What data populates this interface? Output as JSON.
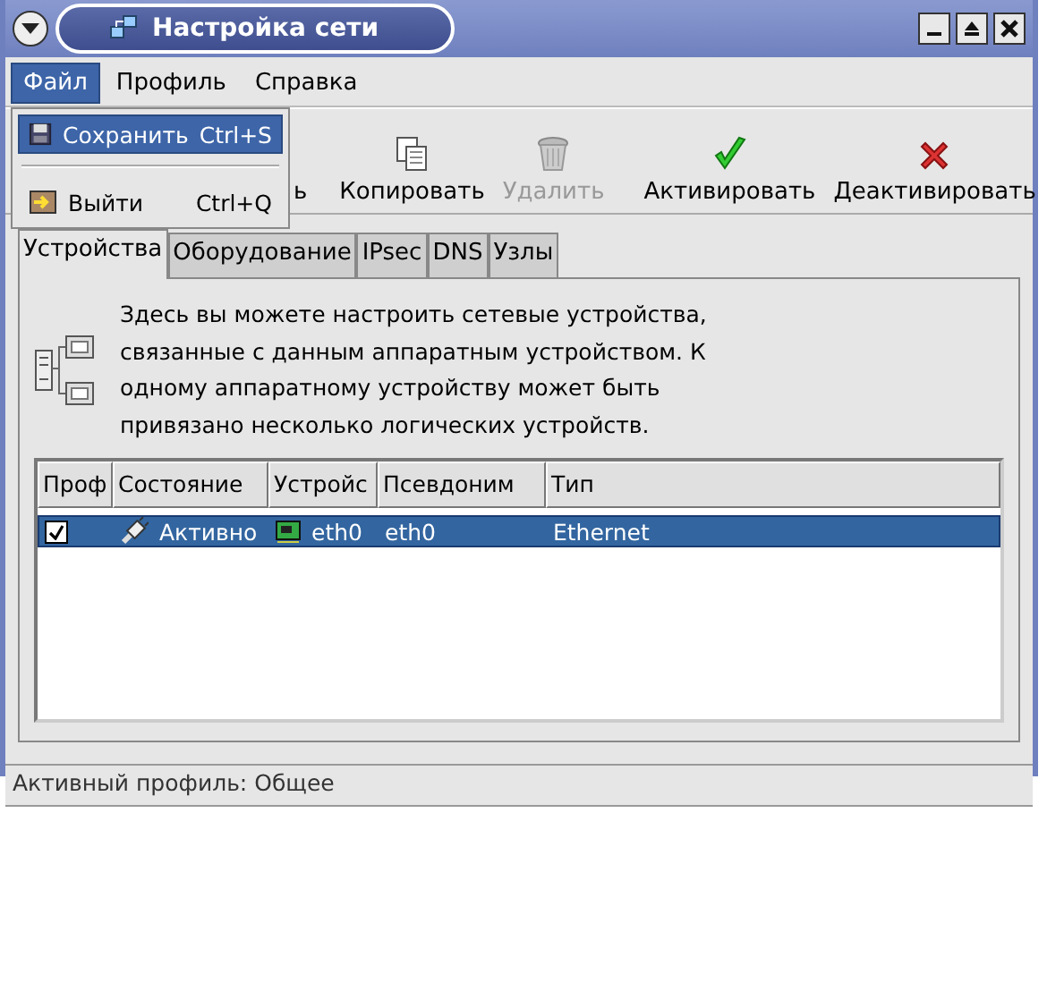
{
  "window": {
    "title": "Настройка сети"
  },
  "menubar": [
    {
      "label": "Файл",
      "selected": true
    },
    {
      "label": "Профиль",
      "selected": false
    },
    {
      "label": "Справка",
      "selected": false
    }
  ],
  "menu": [
    {
      "kind": "save",
      "label": "Сохранить",
      "shortcut": "Ctrl+S",
      "selected": true
    },
    {
      "kind": "quit",
      "label": "Выйти",
      "shortcut": "Ctrl+Q",
      "selected": false
    }
  ],
  "toolbar": [
    {
      "kind": "hidden",
      "label": "ь",
      "disabled": false
    },
    {
      "kind": "copy",
      "label": "Копировать",
      "disabled": false
    },
    {
      "kind": "delete",
      "label": "Удалить",
      "disabled": true
    },
    {
      "kind": "activate",
      "label": "Активировать",
      "disabled": false
    },
    {
      "kind": "deactivate",
      "label": "Деактивировать",
      "disabled": false
    }
  ],
  "tabs": [
    {
      "label": "Устройства",
      "selected": true
    },
    {
      "label": "Оборудование",
      "selected": false
    },
    {
      "label": "IPsec",
      "selected": false
    },
    {
      "label": "DNS",
      "selected": false
    },
    {
      "label": "Узлы",
      "selected": false
    }
  ],
  "description": "Здесь вы можете настроить сетевые устройства,\nсвязанные с данным аппаратным устройством. К\nодному аппаратному устройству может быть\nпривязано несколько логических устройств.",
  "table": {
    "columns": [
      "Проф",
      "Состояние",
      "Устройс",
      "Псевдоним",
      "Тип"
    ],
    "rows": [
      {
        "selected": true,
        "checked": true,
        "status": "Активно",
        "device": "eth0",
        "nickname": "eth0",
        "type": "Ethernet"
      }
    ]
  },
  "status_bar": "Активный профиль: Общее"
}
